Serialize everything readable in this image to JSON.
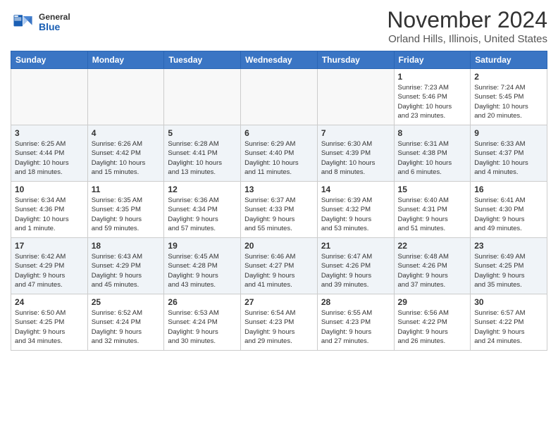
{
  "header": {
    "logo_general": "General",
    "logo_blue": "Blue",
    "month_title": "November 2024",
    "location": "Orland Hills, Illinois, United States"
  },
  "days_of_week": [
    "Sunday",
    "Monday",
    "Tuesday",
    "Wednesday",
    "Thursday",
    "Friday",
    "Saturday"
  ],
  "weeks": [
    [
      {
        "day": "",
        "info": ""
      },
      {
        "day": "",
        "info": ""
      },
      {
        "day": "",
        "info": ""
      },
      {
        "day": "",
        "info": ""
      },
      {
        "day": "",
        "info": ""
      },
      {
        "day": "1",
        "info": "Sunrise: 7:23 AM\nSunset: 5:46 PM\nDaylight: 10 hours\nand 23 minutes."
      },
      {
        "day": "2",
        "info": "Sunrise: 7:24 AM\nSunset: 5:45 PM\nDaylight: 10 hours\nand 20 minutes."
      }
    ],
    [
      {
        "day": "3",
        "info": "Sunrise: 6:25 AM\nSunset: 4:44 PM\nDaylight: 10 hours\nand 18 minutes."
      },
      {
        "day": "4",
        "info": "Sunrise: 6:26 AM\nSunset: 4:42 PM\nDaylight: 10 hours\nand 15 minutes."
      },
      {
        "day": "5",
        "info": "Sunrise: 6:28 AM\nSunset: 4:41 PM\nDaylight: 10 hours\nand 13 minutes."
      },
      {
        "day": "6",
        "info": "Sunrise: 6:29 AM\nSunset: 4:40 PM\nDaylight: 10 hours\nand 11 minutes."
      },
      {
        "day": "7",
        "info": "Sunrise: 6:30 AM\nSunset: 4:39 PM\nDaylight: 10 hours\nand 8 minutes."
      },
      {
        "day": "8",
        "info": "Sunrise: 6:31 AM\nSunset: 4:38 PM\nDaylight: 10 hours\nand 6 minutes."
      },
      {
        "day": "9",
        "info": "Sunrise: 6:33 AM\nSunset: 4:37 PM\nDaylight: 10 hours\nand 4 minutes."
      }
    ],
    [
      {
        "day": "10",
        "info": "Sunrise: 6:34 AM\nSunset: 4:36 PM\nDaylight: 10 hours\nand 1 minute."
      },
      {
        "day": "11",
        "info": "Sunrise: 6:35 AM\nSunset: 4:35 PM\nDaylight: 9 hours\nand 59 minutes."
      },
      {
        "day": "12",
        "info": "Sunrise: 6:36 AM\nSunset: 4:34 PM\nDaylight: 9 hours\nand 57 minutes."
      },
      {
        "day": "13",
        "info": "Sunrise: 6:37 AM\nSunset: 4:33 PM\nDaylight: 9 hours\nand 55 minutes."
      },
      {
        "day": "14",
        "info": "Sunrise: 6:39 AM\nSunset: 4:32 PM\nDaylight: 9 hours\nand 53 minutes."
      },
      {
        "day": "15",
        "info": "Sunrise: 6:40 AM\nSunset: 4:31 PM\nDaylight: 9 hours\nand 51 minutes."
      },
      {
        "day": "16",
        "info": "Sunrise: 6:41 AM\nSunset: 4:30 PM\nDaylight: 9 hours\nand 49 minutes."
      }
    ],
    [
      {
        "day": "17",
        "info": "Sunrise: 6:42 AM\nSunset: 4:29 PM\nDaylight: 9 hours\nand 47 minutes."
      },
      {
        "day": "18",
        "info": "Sunrise: 6:43 AM\nSunset: 4:29 PM\nDaylight: 9 hours\nand 45 minutes."
      },
      {
        "day": "19",
        "info": "Sunrise: 6:45 AM\nSunset: 4:28 PM\nDaylight: 9 hours\nand 43 minutes."
      },
      {
        "day": "20",
        "info": "Sunrise: 6:46 AM\nSunset: 4:27 PM\nDaylight: 9 hours\nand 41 minutes."
      },
      {
        "day": "21",
        "info": "Sunrise: 6:47 AM\nSunset: 4:26 PM\nDaylight: 9 hours\nand 39 minutes."
      },
      {
        "day": "22",
        "info": "Sunrise: 6:48 AM\nSunset: 4:26 PM\nDaylight: 9 hours\nand 37 minutes."
      },
      {
        "day": "23",
        "info": "Sunrise: 6:49 AM\nSunset: 4:25 PM\nDaylight: 9 hours\nand 35 minutes."
      }
    ],
    [
      {
        "day": "24",
        "info": "Sunrise: 6:50 AM\nSunset: 4:25 PM\nDaylight: 9 hours\nand 34 minutes."
      },
      {
        "day": "25",
        "info": "Sunrise: 6:52 AM\nSunset: 4:24 PM\nDaylight: 9 hours\nand 32 minutes."
      },
      {
        "day": "26",
        "info": "Sunrise: 6:53 AM\nSunset: 4:24 PM\nDaylight: 9 hours\nand 30 minutes."
      },
      {
        "day": "27",
        "info": "Sunrise: 6:54 AM\nSunset: 4:23 PM\nDaylight: 9 hours\nand 29 minutes."
      },
      {
        "day": "28",
        "info": "Sunrise: 6:55 AM\nSunset: 4:23 PM\nDaylight: 9 hours\nand 27 minutes."
      },
      {
        "day": "29",
        "info": "Sunrise: 6:56 AM\nSunset: 4:22 PM\nDaylight: 9 hours\nand 26 minutes."
      },
      {
        "day": "30",
        "info": "Sunrise: 6:57 AM\nSunset: 4:22 PM\nDaylight: 9 hours\nand 24 minutes."
      }
    ]
  ]
}
